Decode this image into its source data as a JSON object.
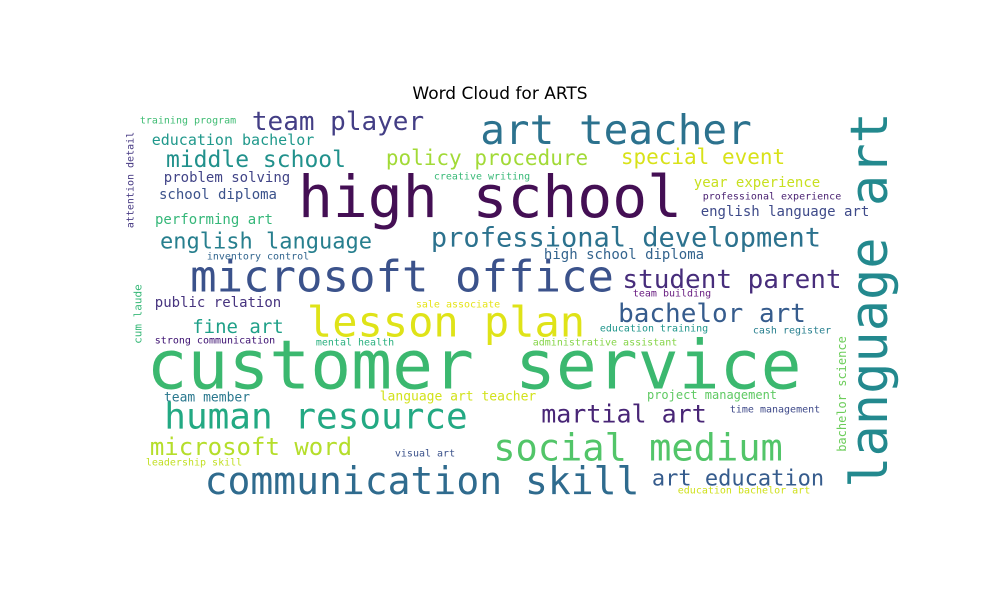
{
  "chart_data": {
    "type": "wordcloud",
    "title": "Word Cloud for ARTS",
    "colormap": "viridis",
    "background": "#ffffff",
    "words": [
      {
        "text": "customer service",
        "weight": 1.0,
        "color": "#3bb86f",
        "orientation": "horizontal"
      },
      {
        "text": "high school",
        "weight": 0.86,
        "color": "#440f54",
        "orientation": "horizontal"
      },
      {
        "text": "language art",
        "weight": 0.77,
        "color": "#23898e",
        "orientation": "vertical"
      },
      {
        "text": "microsoft office",
        "weight": 0.64,
        "color": "#3b528b",
        "orientation": "horizontal"
      },
      {
        "text": "lesson plan",
        "weight": 0.62,
        "color": "#dfe318",
        "orientation": "horizontal"
      },
      {
        "text": "art teacher",
        "weight": 0.6,
        "color": "#2c728e",
        "orientation": "horizontal"
      },
      {
        "text": "communication skill",
        "weight": 0.56,
        "color": "#2f6b8e",
        "orientation": "horizontal"
      },
      {
        "text": "social medium",
        "weight": 0.55,
        "color": "#52c569",
        "orientation": "horizontal"
      },
      {
        "text": "human resource",
        "weight": 0.53,
        "color": "#23a983",
        "orientation": "horizontal"
      },
      {
        "text": "professional development",
        "weight": 0.4,
        "color": "#2c728e",
        "orientation": "horizontal"
      },
      {
        "text": "student parent",
        "weight": 0.38,
        "color": "#472d7b",
        "orientation": "horizontal"
      },
      {
        "text": "team player",
        "weight": 0.38,
        "color": "#433e85",
        "orientation": "horizontal"
      },
      {
        "text": "bachelor art",
        "weight": 0.38,
        "color": "#365c8d",
        "orientation": "horizontal"
      },
      {
        "text": "martial art",
        "weight": 0.37,
        "color": "#482576",
        "orientation": "horizontal"
      },
      {
        "text": "microsoft word",
        "weight": 0.36,
        "color": "#b5de2b",
        "orientation": "horizontal"
      },
      {
        "text": "middle school",
        "weight": 0.34,
        "color": "#21918c",
        "orientation": "horizontal"
      },
      {
        "text": "english language",
        "weight": 0.32,
        "color": "#277f8e",
        "orientation": "horizontal"
      },
      {
        "text": "art education",
        "weight": 0.32,
        "color": "#365c8d",
        "orientation": "horizontal"
      },
      {
        "text": "special event",
        "weight": 0.31,
        "color": "#d8e219",
        "orientation": "horizontal"
      },
      {
        "text": "policy procedure",
        "weight": 0.31,
        "color": "#a2da37",
        "orientation": "horizontal"
      },
      {
        "text": "fine art",
        "weight": 0.28,
        "color": "#1fa088",
        "orientation": "horizontal"
      },
      {
        "text": "education bachelor",
        "weight": 0.22,
        "color": "#1f988b",
        "orientation": "horizontal"
      },
      {
        "text": "school diploma",
        "weight": 0.21,
        "color": "#3b528b",
        "orientation": "horizontal"
      },
      {
        "text": "performing art",
        "weight": 0.21,
        "color": "#35b779",
        "orientation": "horizontal"
      },
      {
        "text": "high school diploma",
        "weight": 0.21,
        "color": "#33638d",
        "orientation": "horizontal"
      },
      {
        "text": "problem solving",
        "weight": 0.2,
        "color": "#414487",
        "orientation": "horizontal"
      },
      {
        "text": "year experience",
        "weight": 0.2,
        "color": "#c8e020",
        "orientation": "horizontal"
      },
      {
        "text": "english language art",
        "weight": 0.2,
        "color": "#3e4a89",
        "orientation": "horizontal"
      },
      {
        "text": "public relation",
        "weight": 0.2,
        "color": "#46337e",
        "orientation": "horizontal"
      },
      {
        "text": "team member",
        "weight": 0.19,
        "color": "#2a788e",
        "orientation": "horizontal"
      },
      {
        "text": "language art teacher",
        "weight": 0.19,
        "color": "#d2e21b",
        "orientation": "horizontal"
      },
      {
        "text": "project management",
        "weight": 0.17,
        "color": "#5ec962",
        "orientation": "horizontal"
      },
      {
        "text": "bachelor science",
        "weight": 0.17,
        "color": "#6ccd5a",
        "orientation": "vertical"
      },
      {
        "text": "cum laude",
        "weight": 0.16,
        "color": "#37b878",
        "orientation": "vertical"
      },
      {
        "text": "education training",
        "weight": 0.15,
        "color": "#1f958b",
        "orientation": "horizontal"
      },
      {
        "text": "leadership skill",
        "weight": 0.15,
        "color": "#c2df23",
        "orientation": "horizontal"
      },
      {
        "text": "training program",
        "weight": 0.13,
        "color": "#3fbc73",
        "orientation": "horizontal"
      },
      {
        "text": "creative writing",
        "weight": 0.13,
        "color": "#38b977",
        "orientation": "horizontal"
      },
      {
        "text": "professional experience",
        "weight": 0.13,
        "color": "#481f70",
        "orientation": "horizontal"
      },
      {
        "text": "attention detail",
        "weight": 0.12,
        "color": "#453882",
        "orientation": "vertical"
      },
      {
        "text": "inventory control",
        "weight": 0.13,
        "color": "#32658e",
        "orientation": "horizontal"
      },
      {
        "text": "sale associate",
        "weight": 0.13,
        "color": "#e5e419",
        "orientation": "horizontal"
      },
      {
        "text": "team building",
        "weight": 0.12,
        "color": "#6a1f82",
        "orientation": "horizontal"
      },
      {
        "text": "strong communication",
        "weight": 0.13,
        "color": "#3b0f70",
        "orientation": "horizontal"
      },
      {
        "text": "mental health",
        "weight": 0.13,
        "color": "#2ab07f",
        "orientation": "horizontal"
      },
      {
        "text": "administrative assistant",
        "weight": 0.13,
        "color": "#86d549",
        "orientation": "horizontal"
      },
      {
        "text": "cash register",
        "weight": 0.13,
        "color": "#277f8e",
        "orientation": "horizontal"
      },
      {
        "text": "time management",
        "weight": 0.13,
        "color": "#3e4989",
        "orientation": "horizontal"
      },
      {
        "text": "visual art",
        "weight": 0.13,
        "color": "#3b528b",
        "orientation": "horizontal"
      },
      {
        "text": "education bachelor art",
        "weight": 0.13,
        "color": "#d0e11c",
        "orientation": "horizontal"
      }
    ]
  }
}
